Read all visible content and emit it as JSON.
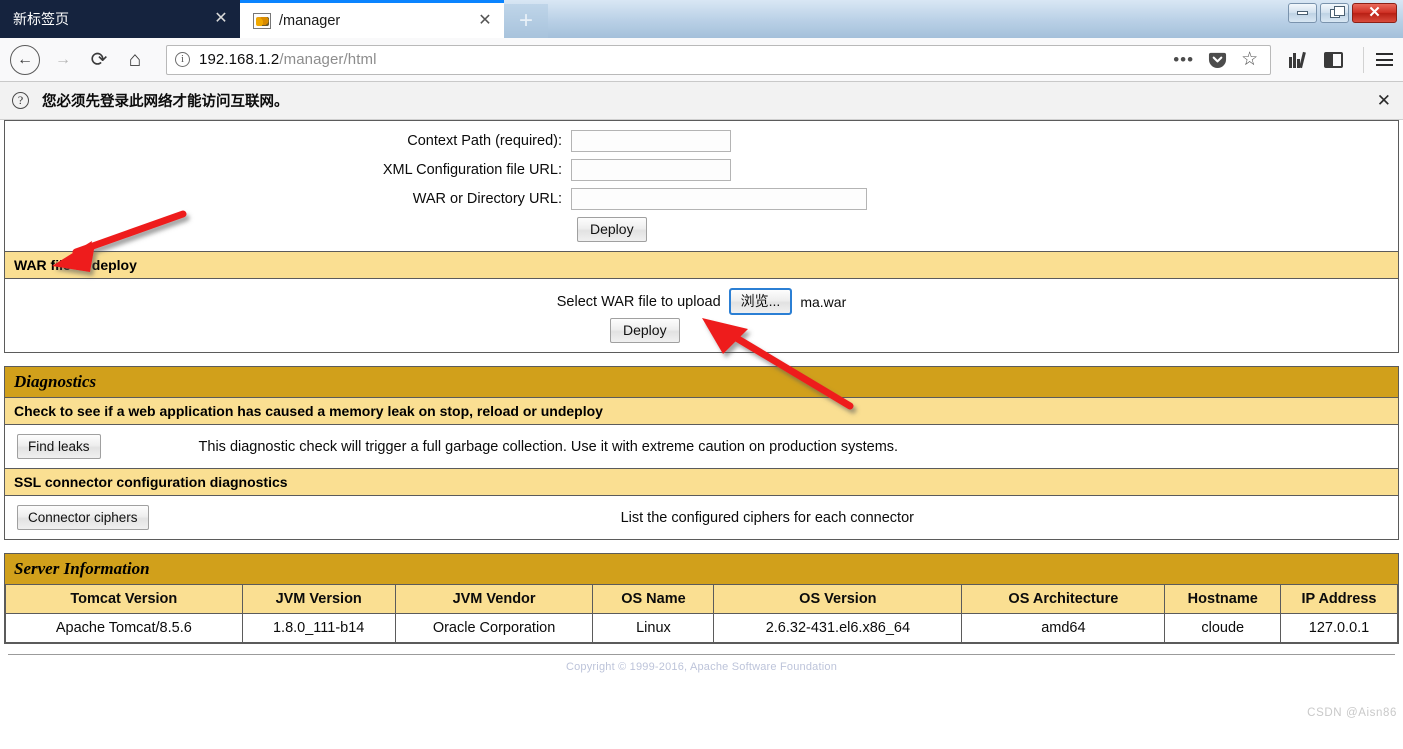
{
  "browser": {
    "tabs": [
      {
        "title": "新标签页",
        "active": false,
        "close_label": "✕",
        "favicon": null
      },
      {
        "title": "/manager",
        "active": true,
        "close_label": "✕",
        "favicon": "tomcat-favicon"
      }
    ],
    "newtab_label": "+",
    "window_controls": {
      "minimize": "minimize",
      "restore": "restore",
      "close": "✕"
    },
    "nav": {
      "back": "←",
      "forward": "→",
      "reload": "⟳",
      "home": "⌂",
      "url_host": "192.168.1.2",
      "url_path": "/manager/html",
      "info_icon": "ⓘ",
      "more_label": "•••",
      "pocket_label": "pocket-icon",
      "star_label": "☆",
      "library_label": "library-icon",
      "sidebar_label": "sidebar-icon",
      "menu_label": "menu-icon"
    },
    "notification": {
      "icon": "?",
      "text": "您必须先登录此网络才能访问互联网。",
      "close": "✕"
    }
  },
  "page": {
    "deploy_form": {
      "fields": [
        {
          "label": "Context Path (required):",
          "value": "",
          "width": "w1"
        },
        {
          "label": "XML Configuration file URL:",
          "value": "",
          "width": "w2"
        },
        {
          "label": "WAR or Directory URL:",
          "value": "",
          "width": "w3"
        }
      ],
      "deploy_button": "Deploy"
    },
    "war_section": {
      "heading": "WAR file to deploy",
      "upload_label": "Select WAR file to upload",
      "browse_button": "浏览...",
      "selected_file": "ma.war",
      "deploy_button": "Deploy"
    },
    "diagnostics": {
      "heading": "Diagnostics",
      "leak_subhead": "Check to see if a web application has caused a memory leak on stop, reload or undeploy",
      "find_leaks_button": "Find leaks",
      "find_leaks_desc": "This diagnostic check will trigger a full garbage collection. Use it with extreme caution on production systems.",
      "ssl_subhead": "SSL connector configuration diagnostics",
      "connector_ciphers_button": "Connector ciphers",
      "connector_ciphers_desc": "List the configured ciphers for each connector"
    },
    "server_info": {
      "heading": "Server Information",
      "columns": [
        "Tomcat Version",
        "JVM Version",
        "JVM Vendor",
        "OS Name",
        "OS Version",
        "OS Architecture",
        "Hostname",
        "IP Address"
      ],
      "rows": [
        [
          "Apache Tomcat/8.5.6",
          "1.8.0_111-b14",
          "Oracle Corporation",
          "Linux",
          "2.6.32-431.el6.x86_64",
          "amd64",
          "cloude",
          "127.0.0.1"
        ]
      ]
    },
    "footer_copyright": "Copyright © 1999-2016, Apache Software Foundation",
    "watermark": "CSDN @Aisn86"
  },
  "annotations": {
    "arrow_color": "#EE1C1C",
    "arrow1_target": "WAR file to deploy",
    "arrow2_target": "ma.war"
  }
}
